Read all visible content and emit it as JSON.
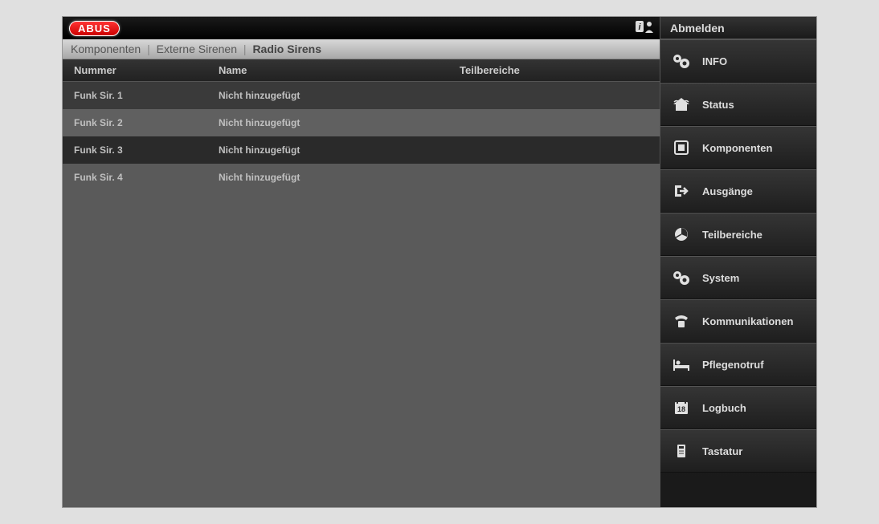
{
  "header": {
    "logo_text": "ABUS",
    "logout_label": "Abmelden"
  },
  "breadcrumb": {
    "items": [
      "Komponenten",
      "Externe Sirenen"
    ],
    "current": "Radio Sirens"
  },
  "table": {
    "columns": {
      "number": "Nummer",
      "name": "Name",
      "sub": "Teilbereiche"
    },
    "rows": [
      {
        "number": "Funk Sir. 1",
        "name": "Nicht hinzugefügt",
        "sub": ""
      },
      {
        "number": "Funk Sir. 2",
        "name": "Nicht hinzugefügt",
        "sub": ""
      },
      {
        "number": "Funk Sir. 3",
        "name": "Nicht hinzugefügt",
        "sub": ""
      },
      {
        "number": "Funk Sir. 4",
        "name": "Nicht hinzugefügt",
        "sub": ""
      }
    ]
  },
  "sidebar": {
    "items": [
      {
        "label": "INFO"
      },
      {
        "label": "Status"
      },
      {
        "label": "Komponenten"
      },
      {
        "label": "Ausgänge"
      },
      {
        "label": "Teilbereiche"
      },
      {
        "label": "System"
      },
      {
        "label": "Kommunikationen"
      },
      {
        "label": "Pflegenotruf"
      },
      {
        "label": "Logbuch"
      },
      {
        "label": "Tastatur"
      }
    ]
  }
}
